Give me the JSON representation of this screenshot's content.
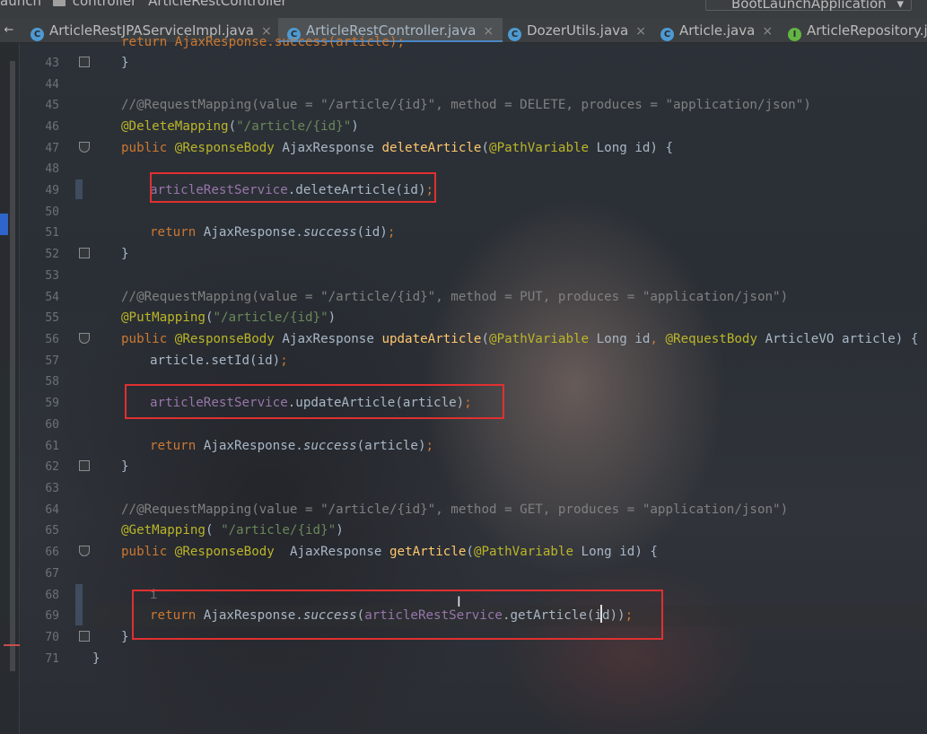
{
  "breadcrumb": {
    "items": [
      "aunch",
      "controller",
      "ArticleRestController"
    ]
  },
  "run_config": {
    "label": "BootLaunchApplication"
  },
  "tabs": [
    {
      "label": "ArticleRestJPAServiceImpl.java",
      "icon": "class-icon",
      "active": false
    },
    {
      "label": "ArticleRestController.java",
      "icon": "class-icon",
      "active": true
    },
    {
      "label": "DozerUtils.java",
      "icon": "class-icon",
      "active": false
    },
    {
      "label": "Article.java",
      "icon": "class-icon",
      "active": false
    },
    {
      "label": "ArticleRepository.j",
      "icon": "interface-icon",
      "active": false
    }
  ],
  "line_numbers": [
    "43",
    "44",
    "45",
    "46",
    "47",
    "48",
    "49",
    "50",
    "51",
    "52",
    "53",
    "54",
    "55",
    "56",
    "57",
    "58",
    "59",
    "60",
    "61",
    "62",
    "63",
    "64",
    "65",
    "66",
    "67",
    "68",
    "69",
    "70",
    "71"
  ],
  "code": {
    "l42": "return AjaxResponse.success(article);",
    "l43": "}",
    "l45": "//@RequestMapping(value = \"/article/{id}\", method = DELETE, produces = \"application/json\")",
    "l46_ann": "@DeleteMapping",
    "l46_str": "\"/article/{id}\"",
    "l47_pub": "public",
    "l47_ann": "@ResponseBody",
    "l47_type": "AjaxResponse",
    "l47_m": "deleteArticle",
    "l47_pann": "@PathVariable",
    "l47_rest": "Long id) {",
    "l49_f": "articleRestService",
    "l49_rest": ".deleteArticle(id)",
    "l51_kw": "return",
    "l51_a": "AjaxResponse.",
    "l51_m": "success",
    "l51_rest": "(id)",
    "l52": "}",
    "l54": "//@RequestMapping(value = \"/article/{id}\", method = PUT, produces = \"application/json\")",
    "l55_ann": "@PutMapping",
    "l55_str": "\"/article/{id}\"",
    "l56_pub": "public",
    "l56_ann": "@ResponseBody",
    "l56_type": "AjaxResponse",
    "l56_m": "updateArticle",
    "l56_pann": "@PathVariable",
    "l56_mid": "Long id",
    "l56_rann": "@RequestBody",
    "l56_rest": "ArticleVO article) {",
    "l57": "article.setId(id)",
    "l59_f": "articleRestService",
    "l59_rest": ".updateArticle(article)",
    "l61_kw": "return",
    "l61_a": "AjaxResponse.",
    "l61_m": "success",
    "l61_rest": "(article)",
    "l62": "}",
    "l64": "//@RequestMapping(value = \"/article/{id}\", method = GET, produces = \"application/json\")",
    "l65_ann": "@GetMapping",
    "l65_str": "\"/article/{id}\"",
    "l66_pub": "public",
    "l66_ann": "@ResponseBody",
    "l66_type": "AjaxResponse",
    "l66_m": "getArticle",
    "l66_pann": "@PathVariable",
    "l66_rest": "Long id) {",
    "l68": "i",
    "l69_kw": "return",
    "l69_a": "AjaxResponse.",
    "l69_m": "success",
    "l69_f": "articleRestService",
    "l69_rest": ".getArticle(id))",
    "l70": "}",
    "l71": "}"
  },
  "colors": {
    "keyword": "#cc7832",
    "annotation": "#bbb529",
    "string": "#6a8759",
    "comment": "#808080",
    "field": "#9876aa",
    "method": "#ffc66d",
    "highlight_box": "#e03030"
  }
}
